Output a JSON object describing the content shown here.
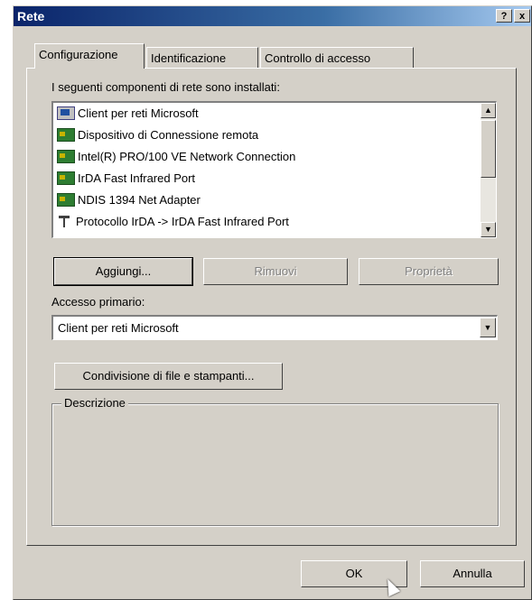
{
  "window": {
    "title": "Rete",
    "help_label": "?",
    "close_label": "x"
  },
  "tabs": [
    {
      "label": "Configurazione",
      "active": true
    },
    {
      "label": "Identificazione",
      "active": false
    },
    {
      "label": "Controllo di accesso",
      "active": false
    }
  ],
  "components": {
    "heading": "I seguenti componenti di rete sono installati:",
    "items": [
      {
        "label": "Client per reti Microsoft",
        "icon": "client-icon"
      },
      {
        "label": "Dispositivo di Connessione remota",
        "icon": "adapter-icon"
      },
      {
        "label": "Intel(R) PRO/100 VE Network Connection",
        "icon": "adapter-icon"
      },
      {
        "label": "IrDA Fast Infrared Port",
        "icon": "adapter-icon"
      },
      {
        "label": "NDIS 1394 Net Adapter",
        "icon": "adapter-icon"
      },
      {
        "label": "Protocollo IrDA -> IrDA Fast Infrared Port",
        "icon": "protocol-icon"
      }
    ],
    "scroll_up": "▲",
    "scroll_down": "▼"
  },
  "buttons": {
    "add": "Aggiungi...",
    "remove": "Rimuovi",
    "properties": "Proprietà",
    "sharing": "Condivisione di file e stampanti...",
    "ok": "OK",
    "cancel": "Annulla"
  },
  "primary_logon": {
    "label": "Accesso primario:",
    "value": "Client per reti Microsoft",
    "arrow": "▼"
  },
  "description": {
    "label": "Descrizione"
  }
}
